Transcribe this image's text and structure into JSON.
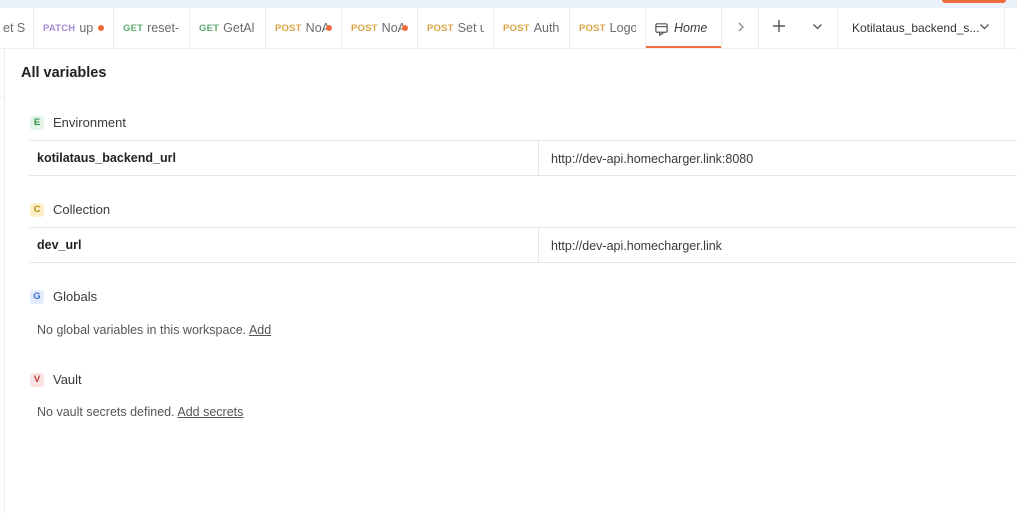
{
  "tabs": [
    {
      "method": "",
      "name": "et S",
      "dirty": false
    },
    {
      "method": "PATCH",
      "name": "up",
      "dirty": true
    },
    {
      "method": "GET",
      "name": "reset-",
      "dirty": false
    },
    {
      "method": "GET",
      "name": "GetAl",
      "dirty": false
    },
    {
      "method": "POST",
      "name": "NoA",
      "dirty": true
    },
    {
      "method": "POST",
      "name": "NoA",
      "dirty": true
    },
    {
      "method": "POST",
      "name": "Set u",
      "dirty": false
    },
    {
      "method": "POST",
      "name": "Auth",
      "dirty": false
    },
    {
      "method": "POST",
      "name": "Logo",
      "dirty": false
    }
  ],
  "active_tab": {
    "label": "Home",
    "icon": "home-workspace-icon"
  },
  "tab_controls": {
    "scroll_right": "chevron-right-icon",
    "new_tab": "plus-icon",
    "tab_menu": "chevron-down-icon"
  },
  "environment_selector": {
    "value": "Kotilataus_backend_s..."
  },
  "page": {
    "title": "All variables"
  },
  "sections": {
    "environment": {
      "badge": "E",
      "label": "Environment",
      "variables": [
        {
          "key": "kotilataus_backend_url",
          "value": "http://dev-api.homecharger.link:8080"
        }
      ]
    },
    "collection": {
      "badge": "C",
      "label": "Collection",
      "variables": [
        {
          "key": "dev_url",
          "value": "http://dev-api.homecharger.link"
        }
      ]
    },
    "globals": {
      "badge": "G",
      "label": "Globals",
      "empty_text": "No global variables in this workspace.",
      "action": "Add"
    },
    "vault": {
      "badge": "V",
      "label": "Vault",
      "empty_text": "No vault secrets defined.",
      "action": "Add secrets"
    }
  },
  "colors": {
    "accent": "#f26b3a",
    "post": "#d9a443",
    "get": "#5fa96f",
    "patch": "#a18ad2"
  }
}
